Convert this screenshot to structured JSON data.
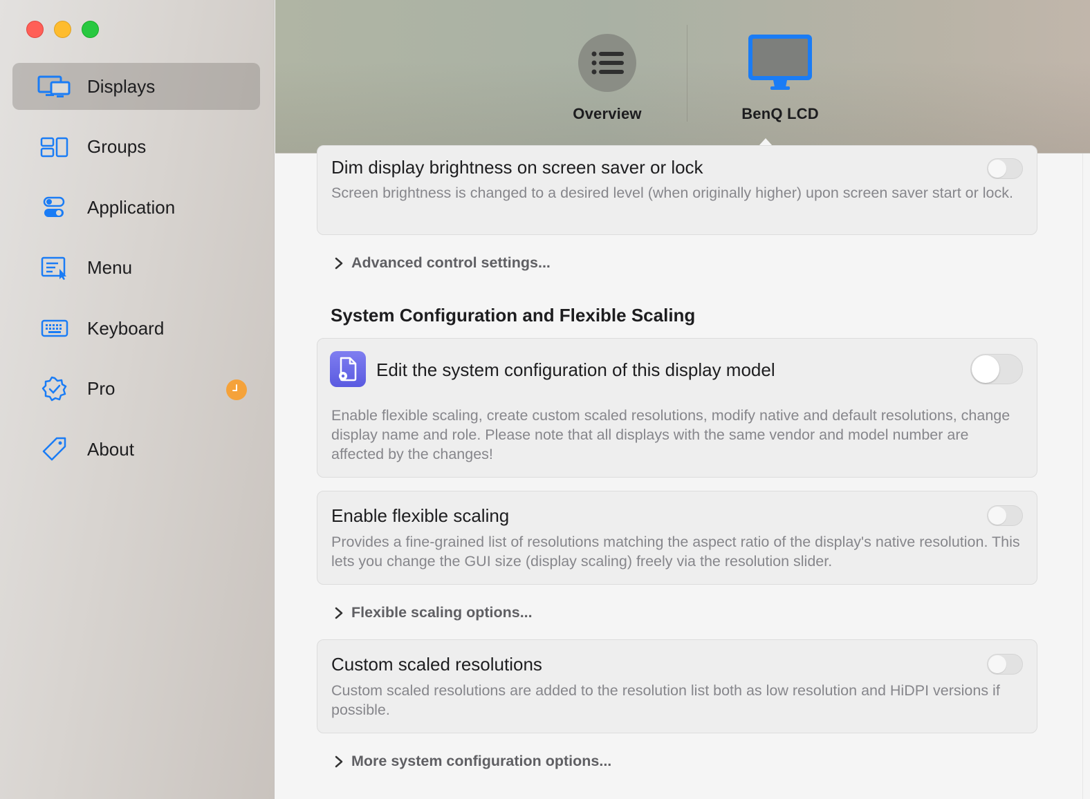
{
  "window": {
    "controls": [
      "close",
      "minimize",
      "zoom"
    ]
  },
  "sidebar": {
    "items": [
      {
        "label": "Displays",
        "icon": "displays-icon",
        "active": true
      },
      {
        "label": "Groups",
        "icon": "groups-icon"
      },
      {
        "label": "Application",
        "icon": "toggles-icon"
      },
      {
        "label": "Menu",
        "icon": "menu-cursor-icon"
      },
      {
        "label": "Keyboard",
        "icon": "keyboard-icon"
      },
      {
        "label": "Pro",
        "icon": "verified-badge-icon",
        "badge": "clock-icon"
      },
      {
        "label": "About",
        "icon": "tag-icon"
      }
    ]
  },
  "header": {
    "tabs": [
      {
        "label": "Overview",
        "icon": "list-icon"
      },
      {
        "label": "BenQ LCD",
        "icon": "monitor-icon",
        "selected": true
      }
    ]
  },
  "content": {
    "dim_card": {
      "title": "Dim display brightness on screen saver or lock",
      "description": "Screen brightness is changed to a desired level (when originally higher) upon screen saver start or lock.",
      "enabled": false
    },
    "advanced_link": "Advanced control settings...",
    "section_title": "System Configuration and Flexible Scaling",
    "edit_config_card": {
      "title": "Edit the system configuration of this display model",
      "description": "Enable flexible scaling, create custom scaled resolutions, modify native and default resolutions, change display name and role. Please note that all displays with the same vendor and model number are affected by the changes!",
      "enabled": false
    },
    "flexible_card": {
      "title": "Enable flexible scaling",
      "description": "Provides a fine-grained list of resolutions matching the aspect ratio of the display's native resolution. This lets you change the GUI size (display scaling) freely via the resolution slider.",
      "enabled": false
    },
    "flexible_link": "Flexible scaling options...",
    "custom_card": {
      "title": "Custom scaled resolutions",
      "description": "Custom scaled resolutions are added to the resolution list both as low resolution and HiDPI versions if possible.",
      "enabled": false
    },
    "more_link": "More system configuration options..."
  },
  "colors": {
    "accent": "#1a7cf5",
    "badge": "#f5a23a",
    "app_icon": "#6b6be8"
  }
}
